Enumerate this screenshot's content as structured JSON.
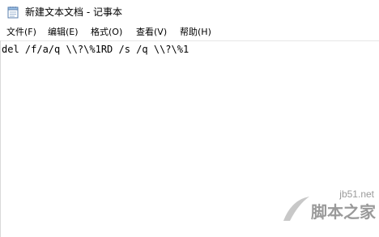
{
  "window": {
    "title": "新建文本文档 - 记事本"
  },
  "menubar": {
    "items": [
      {
        "label": "文件(F)"
      },
      {
        "label": "编辑(E)"
      },
      {
        "label": "格式(O)"
      },
      {
        "label": "查看(V)"
      },
      {
        "label": "帮助(H)"
      }
    ]
  },
  "editor": {
    "text": "del /f/a/q \\\\?\\%1RD /s /q \\\\?\\%1"
  },
  "watermark": {
    "url": "jb51.net",
    "brand": "脚本之家"
  },
  "icons": {
    "app_icon": "notepad-icon"
  },
  "colors": {
    "background": "#ffffff",
    "watermark": "#9a9a9a"
  }
}
